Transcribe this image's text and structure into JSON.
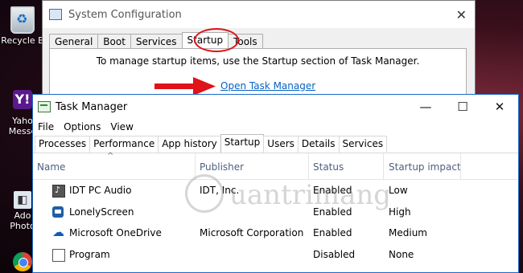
{
  "desktop": {
    "icons": [
      {
        "label": "Recycle B"
      },
      {
        "label": "Yaho\nMesse"
      },
      {
        "label": "Ado\nPhoto"
      },
      {
        "label": ""
      }
    ]
  },
  "sysconfig": {
    "title": "System Configuration",
    "tabs": [
      "General",
      "Boot",
      "Services",
      "Startup",
      "Tools"
    ],
    "active_tab": "Startup",
    "info_text": "To manage startup items, use the Startup section of Task Manager.",
    "link_text": "Open Task Manager",
    "close_glyph": "✕"
  },
  "taskmgr": {
    "title": "Task Manager",
    "menu": [
      "File",
      "Options",
      "View"
    ],
    "tabs": [
      "Processes",
      "Performance",
      "App history",
      "Startup",
      "Users",
      "Details",
      "Services"
    ],
    "active_tab": "Startup",
    "columns": [
      "Name",
      "Publisher",
      "Status",
      "Startup impact"
    ],
    "sort_glyph": "^",
    "controls": {
      "minimize": "—",
      "maximize": "☐",
      "close": "✕"
    },
    "rows": [
      {
        "icon": "audio-icon",
        "name": "IDT PC Audio",
        "publisher": "IDT, Inc.",
        "status": "Enabled",
        "impact": "Low"
      },
      {
        "icon": "screen-icon",
        "name": "LonelyScreen",
        "publisher": "",
        "status": "Enabled",
        "impact": "High"
      },
      {
        "icon": "onedrive-icon",
        "name": "Microsoft OneDrive",
        "publisher": "Microsoft Corporation",
        "status": "Enabled",
        "impact": "Medium"
      },
      {
        "icon": "document-icon",
        "name": "Program",
        "publisher": "",
        "status": "Disabled",
        "impact": "None"
      }
    ]
  },
  "watermark": {
    "text": "uantrimang"
  },
  "colors": {
    "annotation_red": "#e0121a",
    "link_blue": "#0563c1",
    "header_blue": "#4d6082"
  }
}
